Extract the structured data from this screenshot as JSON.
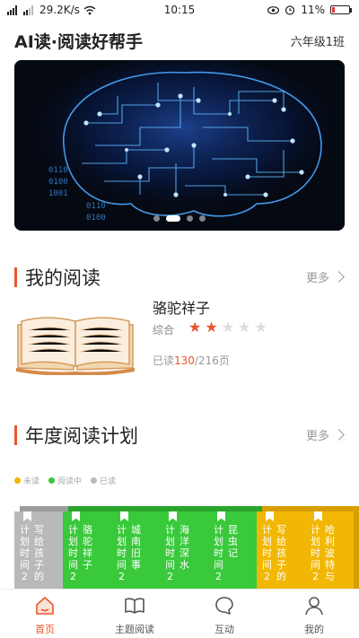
{
  "status_bar": {
    "network_speed": "29.2K/s",
    "time": "10:15",
    "battery": "11%",
    "battery_level": 0.11,
    "colors": {
      "battery_low": "#e53935"
    }
  },
  "header": {
    "title": "AI读·阅读好帮手",
    "class_name": "六年级1班"
  },
  "banner": {
    "image": "circuit-brain-illustration",
    "slide_count": 4,
    "active_slide": 2
  },
  "my_reading": {
    "title": "我的阅读",
    "more_label": "更多",
    "book": {
      "title": "骆驼祥子",
      "category": "综合",
      "rating": 2,
      "rating_max": 5,
      "progress_prefix": "已读",
      "pages_read": "130",
      "pages_total": "/216页"
    }
  },
  "annual_plan": {
    "title": "年度阅读计划",
    "more_label": "更多",
    "legend": [
      {
        "label": "未读",
        "color": "#f2b705"
      },
      {
        "label": "阅读中",
        "color": "#38c83a"
      },
      {
        "label": "已读",
        "color": "#bbbbbb"
      }
    ],
    "books": [
      {
        "title": "写给孩子的",
        "date": "计划时间2",
        "status": "已读",
        "color": "#b9b9b9",
        "side": "#9c9c9c"
      },
      {
        "title": "骆驼祥子",
        "date": "计划时间2",
        "status": "阅读中",
        "color": "#39c93b",
        "side": "#2aa52c"
      },
      {
        "title": "城南旧事",
        "date": "计划时间2",
        "status": "阅读中",
        "color": "#39c93b",
        "side": "#2aa52c"
      },
      {
        "title": "海洋深水",
        "date": "计划时间2",
        "status": "阅读中",
        "color": "#39c93b",
        "side": "#2aa52c"
      },
      {
        "title": "昆虫记",
        "date": "计划时间2",
        "status": "阅读中",
        "color": "#39c93b",
        "side": "#2aa52c"
      },
      {
        "title": "写给孩子的",
        "date": "计划时间2",
        "status": "未读",
        "color": "#f2b705",
        "side": "#d89e00"
      },
      {
        "title": "哈利波特与",
        "date": "计划时间2",
        "status": "未读",
        "color": "#f2b705",
        "side": "#d89e00"
      }
    ]
  },
  "tabbar": {
    "items": [
      {
        "label": "首页",
        "icon": "home-icon",
        "active": true
      },
      {
        "label": "主题阅读",
        "icon": "open-book-icon",
        "active": false
      },
      {
        "label": "互动",
        "icon": "chat-bubble-icon",
        "active": false
      },
      {
        "label": "我的",
        "icon": "user-icon",
        "active": false
      }
    ],
    "colors": {
      "active": "#e8562a",
      "inactive": "#555555"
    }
  },
  "colors": {
    "accent": "#e8562a",
    "star_on": "#e8562a",
    "star_off": "#dddddd"
  }
}
